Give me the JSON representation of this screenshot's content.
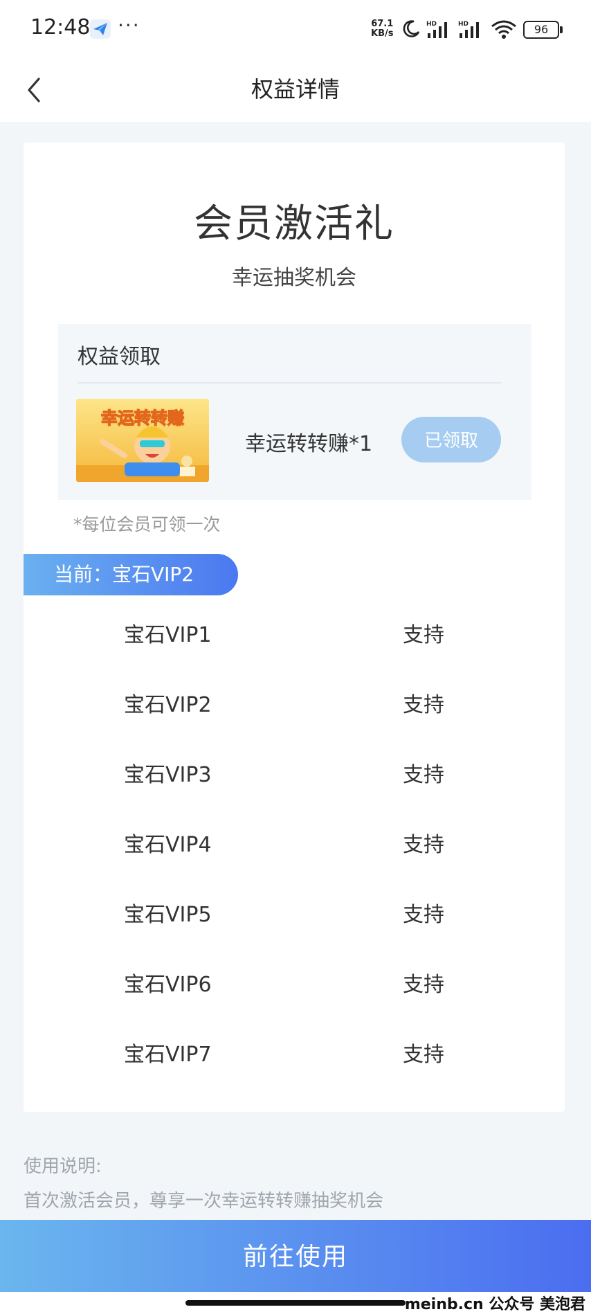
{
  "status_bar": {
    "time": "12:48",
    "more": "···",
    "net_speed_value": "67.1",
    "net_speed_unit": "KB/s",
    "battery": "96"
  },
  "header": {
    "title": "权益详情"
  },
  "card": {
    "title": "会员激活礼",
    "subtitle": "幸运抽奖机会",
    "claim": {
      "heading": "权益领取",
      "thumb_text": "幸运转转赚",
      "item_name": "幸运转转赚*1",
      "button_label": "已领取"
    },
    "note": "*每位会员可领一次",
    "current_tag": "当前：宝石VIP2",
    "levels": [
      {
        "name": "宝石VIP1",
        "value": "支持"
      },
      {
        "name": "宝石VIP2",
        "value": "支持"
      },
      {
        "name": "宝石VIP3",
        "value": "支持"
      },
      {
        "name": "宝石VIP4",
        "value": "支持"
      },
      {
        "name": "宝石VIP5",
        "value": "支持"
      },
      {
        "name": "宝石VIP6",
        "value": "支持"
      },
      {
        "name": "宝石VIP7",
        "value": "支持"
      }
    ]
  },
  "usage": {
    "title": "使用说明:",
    "text": "首次激活会员，尊享一次幸运转转赚抽奖机会"
  },
  "cta_label": "前往使用",
  "watermark": "meinb.cn  公众号 美泡君",
  "colors": {
    "accent_start": "#6ab6ee",
    "accent_end": "#4b6df0",
    "claimed_button": "#a6ccf2"
  }
}
